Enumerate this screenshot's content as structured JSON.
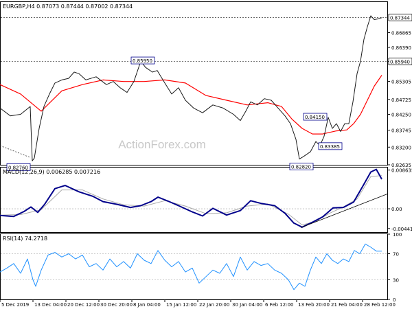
{
  "colors": {
    "price": "#1a1a1a",
    "ma": "#ff0000",
    "macd": "#00008b",
    "signal": "#aaaaaa",
    "rsi": "#1e90ff",
    "level_box": "#00008b",
    "trendline": "#000000",
    "watermark": "#c8c8c8"
  },
  "watermark": "ActionForex.com",
  "chart_data": [
    {
      "type": "line",
      "title": "EURGBP,H4  0.87073 0.87444 0.87002 0.87344",
      "ylim": [
        0.82635,
        0.8784
      ],
      "y_ticks": [
        0.86865,
        0.8639,
        0.8594,
        0.85305,
        0.84725,
        0.8425,
        0.83745,
        0.832,
        0.82635
      ],
      "last_price": 0.87344,
      "x_ticks": [
        "5 Dec 2019",
        "13 Dec 04:00",
        "20 Dec 12:00",
        "30 Dec 20:00",
        "8 Jan 04:00",
        "15 Jan 12:00",
        "22 Jan 20:00",
        "30 Jan 04:00",
        "6 Feb 12:00",
        "13 Feb 20:00",
        "21 Feb 04:00",
        "28 Feb 12:00"
      ],
      "x_ticks_t": [
        0,
        48,
        96,
        144,
        192,
        240,
        288,
        336,
        384,
        432,
        480,
        528
      ],
      "xlim": [
        0,
        564
      ],
      "series": [
        {
          "key": "price",
          "x": [
            0,
            15,
            30,
            44,
            47,
            50,
            57,
            64,
            72,
            80,
            90,
            100,
            108,
            115,
            125,
            140,
            155,
            165,
            175,
            185,
            195,
            205,
            212,
            222,
            229,
            240,
            250,
            260,
            270,
            282,
            295,
            310,
            325,
            340,
            350,
            358,
            365,
            375,
            385,
            395,
            405,
            415,
            423,
            431,
            436,
            442,
            452,
            460,
            466,
            472,
            478,
            484,
            490,
            496,
            502,
            508,
            514,
            520,
            525,
            530,
            535,
            540,
            545,
            550,
            556
          ],
          "y": [
            0.8445,
            0.842,
            0.8425,
            0.845,
            0.8276,
            0.8285,
            0.838,
            0.845,
            0.849,
            0.8525,
            0.8535,
            0.854,
            0.856,
            0.8555,
            0.8535,
            0.8545,
            0.852,
            0.853,
            0.851,
            0.8495,
            0.853,
            0.8595,
            0.8575,
            0.856,
            0.8565,
            0.8525,
            0.849,
            0.851,
            0.847,
            0.8445,
            0.843,
            0.8455,
            0.8445,
            0.8425,
            0.8405,
            0.8435,
            0.8465,
            0.8455,
            0.8475,
            0.847,
            0.8445,
            0.842,
            0.8395,
            0.8345,
            0.8282,
            0.829,
            0.8305,
            0.8338,
            0.8325,
            0.8355,
            0.8415,
            0.838,
            0.8395,
            0.837,
            0.8395,
            0.8395,
            0.8465,
            0.8555,
            0.8595,
            0.8665,
            0.8705,
            0.874,
            0.8728,
            0.873,
            0.8734
          ]
        },
        {
          "key": "ma",
          "x": [
            0,
            30,
            60,
            90,
            120,
            150,
            180,
            210,
            240,
            270,
            300,
            330,
            360,
            390,
            410,
            425,
            440,
            455,
            470,
            490,
            505,
            515,
            525,
            535,
            545,
            556
          ],
          "y": [
            0.852,
            0.849,
            0.8435,
            0.85,
            0.852,
            0.8535,
            0.853,
            0.853,
            0.8535,
            0.8525,
            0.8485,
            0.847,
            0.8455,
            0.8462,
            0.845,
            0.841,
            0.838,
            0.8362,
            0.8362,
            0.8372,
            0.8375,
            0.8395,
            0.8425,
            0.847,
            0.8515,
            0.855
          ]
        }
      ],
      "levels": [
        {
          "label": "0.82760",
          "value": 0.8276,
          "t": 44
        },
        {
          "label": "0.85950",
          "value": 0.8595,
          "t": 205
        },
        {
          "label": "0.84150",
          "value": 0.8415,
          "t": 476
        },
        {
          "label": "0.83385",
          "value": 0.83385,
          "t": 484
        },
        {
          "label": "0.82820",
          "value": 0.8282,
          "t": 436
        }
      ],
      "hlines": [
        {
          "label": "0.85940",
          "value": 0.8594
        },
        {
          "label": "0.87344",
          "value": 0.87344
        }
      ]
    },
    {
      "type": "line",
      "title": "MACD(12,26,9) 0.006285 0.007216",
      "ylim": [
        -0.0052,
        0.0092
      ],
      "y_ticks": [
        0.008635,
        0.0,
        -0.004415
      ],
      "y_tick_labels": [
        "0.008635",
        "0.00",
        "-0.004415"
      ],
      "xlim": [
        0,
        564
      ],
      "series": [
        {
          "key": "macd",
          "x": [
            0,
            20,
            35,
            45,
            55,
            65,
            80,
            95,
            115,
            135,
            150,
            170,
            190,
            205,
            220,
            230,
            245,
            260,
            280,
            295,
            310,
            330,
            350,
            365,
            380,
            400,
            415,
            428,
            440,
            455,
            470,
            485,
            500,
            515,
            530,
            540,
            548,
            556
          ],
          "y": [
            -0.0015,
            -0.0017,
            -0.0006,
            0.0004,
            -0.0008,
            0.001,
            0.0045,
            0.0052,
            0.0038,
            0.0028,
            0.0016,
            0.001,
            0.0003,
            0.0007,
            0.0016,
            0.0026,
            0.0017,
            0.0007,
            -0.0007,
            -0.0016,
            0.0001,
            -0.0014,
            -0.0004,
            0.0018,
            0.0012,
            0.0007,
            -0.001,
            -0.0032,
            -0.0041,
            -0.003,
            -0.0018,
            0.0002,
            0.0003,
            0.0015,
            0.0055,
            0.0082,
            0.0088,
            0.0066
          ]
        },
        {
          "key": "signal",
          "x": [
            0,
            30,
            60,
            90,
            120,
            150,
            180,
            210,
            240,
            270,
            300,
            330,
            360,
            390,
            420,
            440,
            460,
            480,
            500,
            520,
            540,
            556
          ],
          "y": [
            -0.0014,
            -0.0013,
            -0.0002,
            0.0042,
            0.0042,
            0.0022,
            0.0009,
            0.0006,
            0.0018,
            0.0006,
            -0.0011,
            -0.0009,
            0.0006,
            0.0011,
            -0.0012,
            -0.0036,
            -0.0028,
            -0.001,
            0.0004,
            0.0022,
            0.0072,
            0.0074
          ]
        }
      ],
      "trendline": {
        "from": [
          438,
          -0.0042
        ],
        "to": [
          564,
          0.0033
        ]
      }
    },
    {
      "type": "line",
      "title": "RSI(14) 74.2718",
      "ylim": [
        0,
        100
      ],
      "y_ticks": [
        100,
        70,
        30,
        0
      ],
      "hlines": [
        70,
        30
      ],
      "xlim": [
        0,
        564
      ],
      "series": [
        {
          "key": "rsi",
          "x": [
            0,
            10,
            20,
            30,
            40,
            48,
            52,
            60,
            70,
            80,
            90,
            100,
            110,
            120,
            130,
            140,
            150,
            160,
            170,
            180,
            190,
            200,
            210,
            220,
            230,
            240,
            250,
            260,
            270,
            280,
            290,
            300,
            310,
            320,
            330,
            340,
            350,
            360,
            370,
            380,
            390,
            400,
            410,
            420,
            428,
            436,
            444,
            452,
            460,
            468,
            476,
            484,
            492,
            500,
            508,
            516,
            524,
            532,
            540,
            548,
            556
          ],
          "y": [
            42,
            48,
            55,
            40,
            62,
            30,
            20,
            45,
            68,
            72,
            65,
            70,
            62,
            68,
            50,
            55,
            45,
            62,
            50,
            58,
            48,
            70,
            60,
            55,
            75,
            60,
            50,
            58,
            42,
            48,
            25,
            35,
            45,
            40,
            55,
            35,
            65,
            45,
            58,
            52,
            55,
            45,
            40,
            30,
            15,
            25,
            20,
            45,
            65,
            55,
            70,
            60,
            55,
            62,
            58,
            75,
            70,
            85,
            80,
            74,
            74
          ]
        }
      ]
    }
  ]
}
